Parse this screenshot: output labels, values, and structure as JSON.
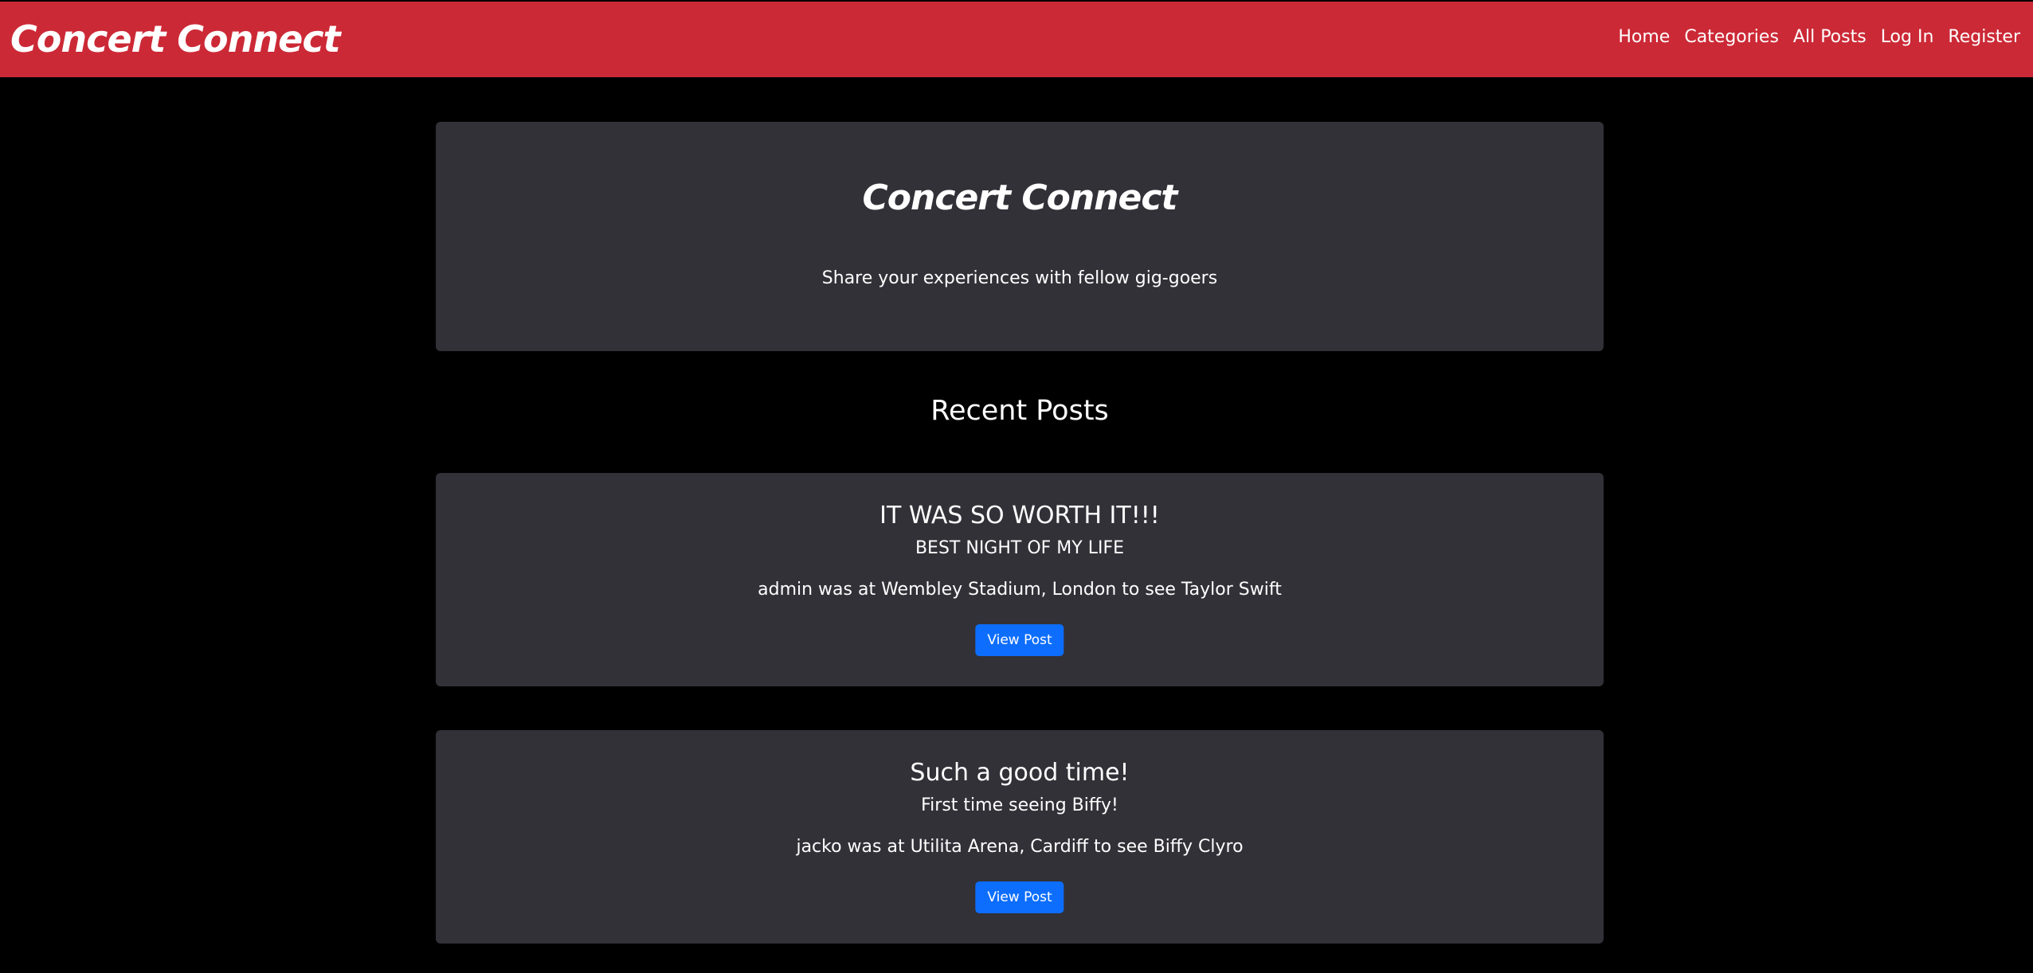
{
  "navbar": {
    "brand": "Concert Connect",
    "links": [
      "Home",
      "Categories",
      "All Posts",
      "Log In",
      "Register"
    ]
  },
  "hero": {
    "title": "Concert Connect",
    "subtitle": "Share your experiences with fellow gig-goers"
  },
  "recent_heading": "Recent Posts",
  "posts": [
    {
      "title": "IT WAS SO WORTH IT!!!",
      "subtitle": "BEST NIGHT OF MY LIFE",
      "meta": "admin was at Wembley Stadium, London to see Taylor Swift",
      "button": "View Post"
    },
    {
      "title": "Such a good time!",
      "subtitle": "First time seeing Biffy!",
      "meta": "jacko was at Utilita Arena, Cardiff to see Biffy Clyro",
      "button": "View Post"
    }
  ],
  "colors": {
    "navbar": "#cc2936",
    "card": "#323138",
    "button": "#0d6efd",
    "background": "#000000"
  }
}
